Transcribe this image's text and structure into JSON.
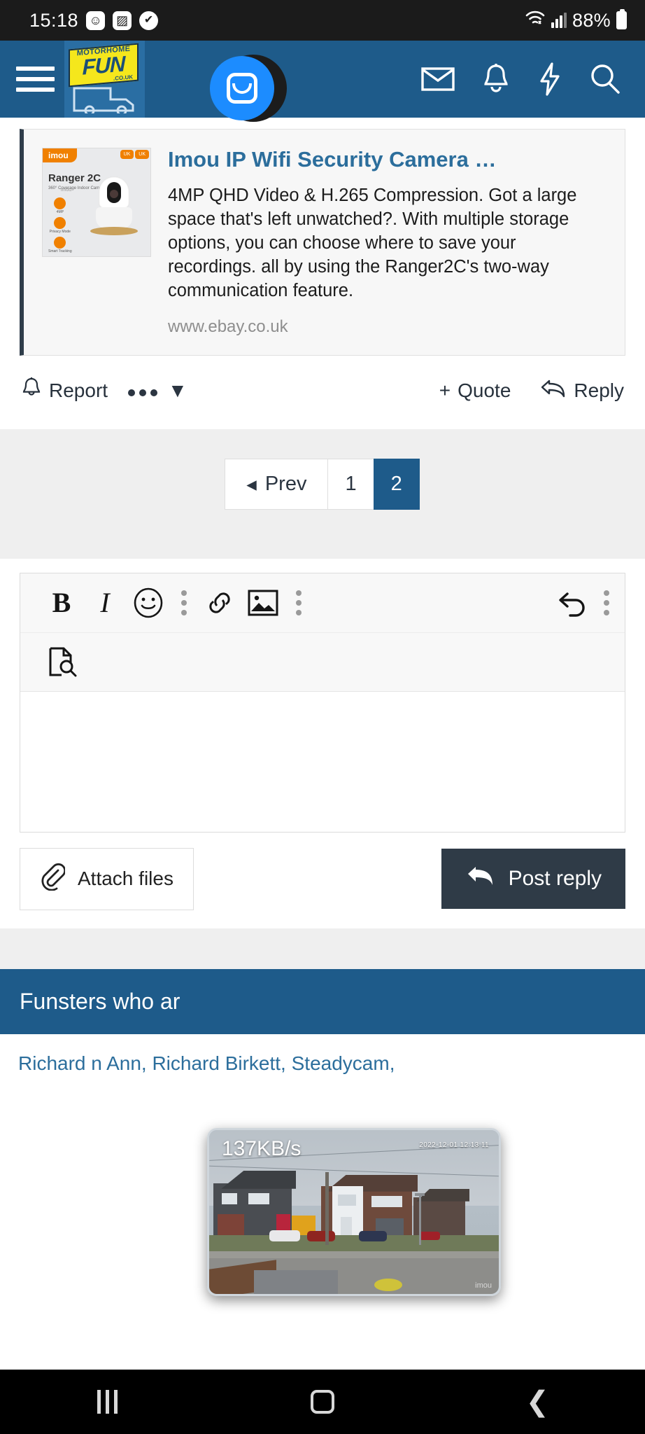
{
  "statusbar": {
    "time": "15:18",
    "icons": [
      "smiley-badge-icon",
      "image-badge-icon",
      "check-circle-icon"
    ],
    "smiley_glyph": "☺",
    "image_glyph": "▨",
    "check_glyph": "✔",
    "battery_percent": "88%",
    "wifi_icon": "wifi-icon",
    "signal_icon": "signal-bars-icon"
  },
  "header": {
    "menu_icon": "hamburger-menu-icon",
    "logo": {
      "top_text": "MOTORHOME",
      "main_text": "FUN",
      "small_text": ".CO.UK",
      "name": "motorhome-fun-logo"
    },
    "icons": [
      {
        "name": "mail-icon",
        "glyph": "✉"
      },
      {
        "name": "bell-icon",
        "glyph": "🔔"
      },
      {
        "name": "lightning-icon",
        "glyph": "⚡"
      },
      {
        "name": "search-icon",
        "glyph": "🔍"
      }
    ],
    "chat_bubble": {
      "name": "floating-chat-head",
      "color": "#1c8cff"
    }
  },
  "link_preview": {
    "title": "Imou IP Wifi Security Camera …",
    "description": "4MP QHD Video & H.265 Compression. Got a large space that's left unwatched?. With multiple storage options, you can choose where to save your recordings. all by using the Ranger2C's two-way communication feature.",
    "domain": "www.ebay.co.uk",
    "thumbnail": {
      "brand": "imou",
      "model": "Ranger 2C",
      "subtitle": "360° Coverage Indoor Camera",
      "badge_left": "UK",
      "badge_right": "UK",
      "features": [
        "4MP",
        "Privacy Mode",
        "Smart Tracking"
      ],
      "watermark": "imou"
    }
  },
  "post_actions": {
    "report": "Report",
    "report_icon": "bell-icon",
    "more_icon": "more-dots-icon",
    "more_caret": "▼",
    "quote": "Quote",
    "quote_plus": "+",
    "reply": "Reply",
    "reply_icon": "reply-arrow-icon"
  },
  "pagination": {
    "prev_label": "Prev",
    "prev_caret": "◂",
    "pages": [
      "1",
      "2"
    ],
    "active_page": "2"
  },
  "editor": {
    "toolbar_row1": [
      {
        "name": "bold-button",
        "glyph": "B"
      },
      {
        "name": "italic-button",
        "glyph": "I"
      },
      {
        "name": "emoji-button",
        "glyph": "☺"
      },
      {
        "name": "more-options-1",
        "glyph": "vertical-dots"
      },
      {
        "name": "link-button",
        "glyph": "link-icon"
      },
      {
        "name": "insert-image-button",
        "glyph": "image-icon"
      },
      {
        "name": "more-options-2",
        "glyph": "vertical-dots"
      },
      {
        "name": "undo-button",
        "glyph": "undo-icon"
      },
      {
        "name": "more-options-3",
        "glyph": "vertical-dots"
      }
    ],
    "toolbar_row2": [
      {
        "name": "preview-document-button",
        "glyph": "document-search-icon"
      }
    ],
    "body_value": "",
    "body_placeholder": ""
  },
  "submit_row": {
    "attach_label": "Attach files",
    "attach_icon": "paperclip-icon",
    "post_label": "Post reply",
    "post_icon": "reply-arrow-icon"
  },
  "footer": {
    "viewers_heading": "Funsters who ar",
    "viewers_list": "Richard n Ann, Richard Birkett, Steadycam,"
  },
  "pip_camera": {
    "bitrate": "137KB/s",
    "timestamp": "2022-12-01 12:13:11",
    "watermark": "imou",
    "scene": "street-view-houses"
  },
  "navbar": {
    "recents_icon": "recents-icon",
    "home_icon": "home-icon",
    "back_icon": "back-icon",
    "back_glyph": "❮"
  },
  "colors": {
    "header_blue": "#1e5b8a",
    "link_blue": "#2c6e9c",
    "dark_slate": "#2f3b47",
    "logo_yellow": "#f5e71c",
    "accent_orange": "#f08000"
  }
}
